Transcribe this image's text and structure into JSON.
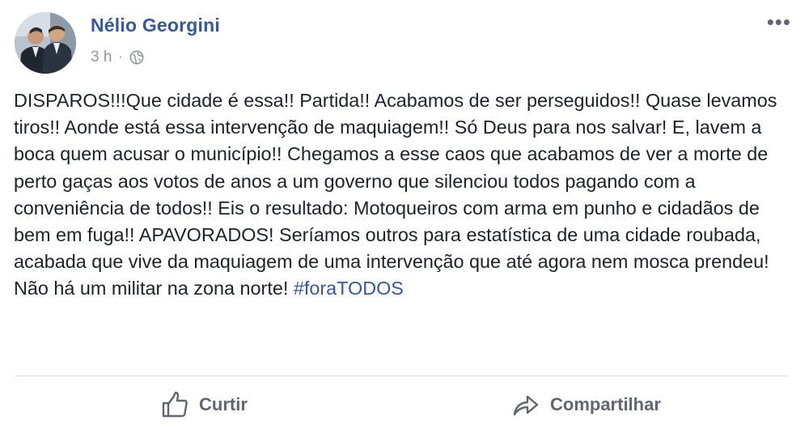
{
  "post": {
    "author": "Nélio Georgini",
    "timestamp": "3 h",
    "separator": "·",
    "privacy_icon": "globe-icon",
    "menu_icon": "more-options-icon",
    "menu_label": "•••",
    "text": "DISPAROS!!!Que cidade é essa!! Partida!! Acabamos de ser perseguidos!! Quase levamos tiros!! Aonde está essa intervenção de maquiagem!! Só Deus para nos salvar! E, lavem a boca quem acusar o município!! Chegamos a esse caos que acabamos de ver a morte de perto gaças aos votos de anos a um governo que silenciou todos pagando com a conveniência de todos!! Eis o resultado: Motoqueiros com arma em punho e cidadãos de bem em fuga!! APAVORADOS! Seríamos outros para estatística de uma cidade roubada, acabada que vive da maquiagem de uma intervenção que até agora nem mosca prendeu! Não há um militar na zona norte!",
    "hashtag": "#foraTODOS"
  },
  "actions": {
    "like_label": "Curtir",
    "like_icon": "thumbs-up-icon",
    "share_label": "Compartilhar",
    "share_icon": "share-arrow-icon"
  },
  "colors": {
    "author_link": "#365899",
    "meta_gray": "#90949c",
    "action_gray": "#606770",
    "divider": "#dadde1"
  }
}
